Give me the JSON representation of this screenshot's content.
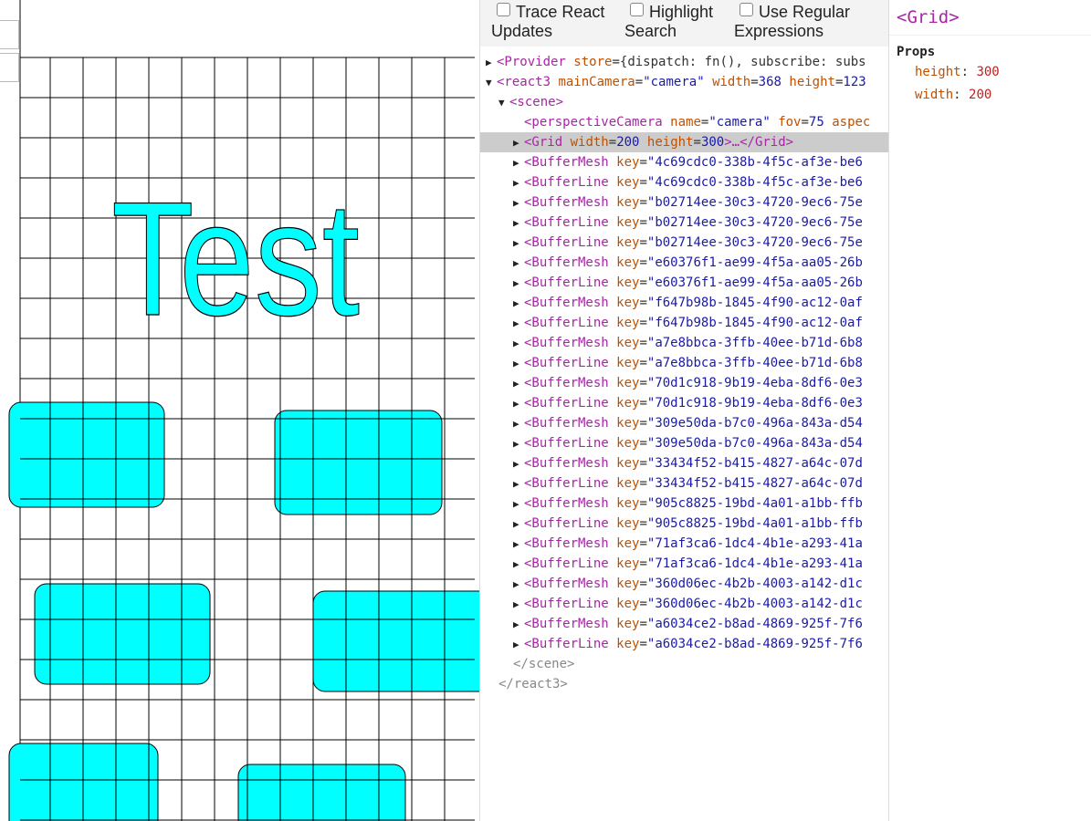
{
  "toolbar": {
    "trace_react_updates": {
      "label_line1": "Trace React",
      "label_line2": "Updates"
    },
    "highlight_search": {
      "label_line1": "Highlight",
      "label_line2": "Search"
    },
    "use_regex": {
      "label_line1": "Use Regular",
      "label_line2": "Expressions"
    }
  },
  "canvas": {
    "text": "Test",
    "fill_color": "#00ffff"
  },
  "tree": {
    "provider": {
      "tag": "<Provider",
      "attr": "store",
      "value": "{dispatch: fn(), subscribe: subs"
    },
    "react3": {
      "tag": "<react3",
      "attrs": [
        {
          "k": "mainCamera",
          "v": "\"camera\""
        },
        {
          "k": "width",
          "v": "368"
        },
        {
          "k": "height",
          "v": "123"
        }
      ]
    },
    "scene_open": "<scene>",
    "camera": {
      "tag": "<perspectiveCamera",
      "attrs": [
        {
          "k": "name",
          "v": "\"camera\""
        },
        {
          "k": "fov",
          "v": "75"
        },
        {
          "k": "aspec",
          "v": ""
        }
      ]
    },
    "grid": {
      "tag": "<Grid",
      "attrs": [
        {
          "k": "width",
          "v": "200"
        },
        {
          "k": "height",
          "v": "300"
        }
      ],
      "tail": ">…</Grid>"
    },
    "items": [
      {
        "tag": "<BufferMesh",
        "key": "\"4c69cdc0-338b-4f5c-af3e-be6"
      },
      {
        "tag": "<BufferLine",
        "key": "\"4c69cdc0-338b-4f5c-af3e-be6"
      },
      {
        "tag": "<BufferMesh",
        "key": "\"b02714ee-30c3-4720-9ec6-75e"
      },
      {
        "tag": "<BufferLine",
        "key": "\"b02714ee-30c3-4720-9ec6-75e"
      },
      {
        "tag": "<BufferLine",
        "key": "\"b02714ee-30c3-4720-9ec6-75e"
      },
      {
        "tag": "<BufferMesh",
        "key": "\"e60376f1-ae99-4f5a-aa05-26b"
      },
      {
        "tag": "<BufferLine",
        "key": "\"e60376f1-ae99-4f5a-aa05-26b"
      },
      {
        "tag": "<BufferMesh",
        "key": "\"f647b98b-1845-4f90-ac12-0af"
      },
      {
        "tag": "<BufferLine",
        "key": "\"f647b98b-1845-4f90-ac12-0af"
      },
      {
        "tag": "<BufferMesh",
        "key": "\"a7e8bbca-3ffb-40ee-b71d-6b8"
      },
      {
        "tag": "<BufferLine",
        "key": "\"a7e8bbca-3ffb-40ee-b71d-6b8"
      },
      {
        "tag": "<BufferMesh",
        "key": "\"70d1c918-9b19-4eba-8df6-0e3"
      },
      {
        "tag": "<BufferLine",
        "key": "\"70d1c918-9b19-4eba-8df6-0e3"
      },
      {
        "tag": "<BufferMesh",
        "key": "\"309e50da-b7c0-496a-843a-d54"
      },
      {
        "tag": "<BufferLine",
        "key": "\"309e50da-b7c0-496a-843a-d54"
      },
      {
        "tag": "<BufferMesh",
        "key": "\"33434f52-b415-4827-a64c-07d"
      },
      {
        "tag": "<BufferLine",
        "key": "\"33434f52-b415-4827-a64c-07d"
      },
      {
        "tag": "<BufferMesh",
        "key": "\"905c8825-19bd-4a01-a1bb-ffb"
      },
      {
        "tag": "<BufferLine",
        "key": "\"905c8825-19bd-4a01-a1bb-ffb"
      },
      {
        "tag": "<BufferMesh",
        "key": "\"71af3ca6-1dc4-4b1e-a293-41a"
      },
      {
        "tag": "<BufferLine",
        "key": "\"71af3ca6-1dc4-4b1e-a293-41a"
      },
      {
        "tag": "<BufferMesh",
        "key": "\"360d06ec-4b2b-4003-a142-d1c"
      },
      {
        "tag": "<BufferLine",
        "key": "\"360d06ec-4b2b-4003-a142-d1c"
      },
      {
        "tag": "<BufferMesh",
        "key": "\"a6034ce2-b8ad-4869-925f-7f6"
      },
      {
        "tag": "<BufferLine",
        "key": "\"a6034ce2-b8ad-4869-925f-7f6"
      }
    ],
    "scene_close": "</scene>",
    "react3_close": "</react3>"
  },
  "props_panel": {
    "title": "<Grid>",
    "heading": "Props",
    "props": [
      {
        "key": "height",
        "value": "300"
      },
      {
        "key": "width",
        "value": "200"
      }
    ]
  }
}
